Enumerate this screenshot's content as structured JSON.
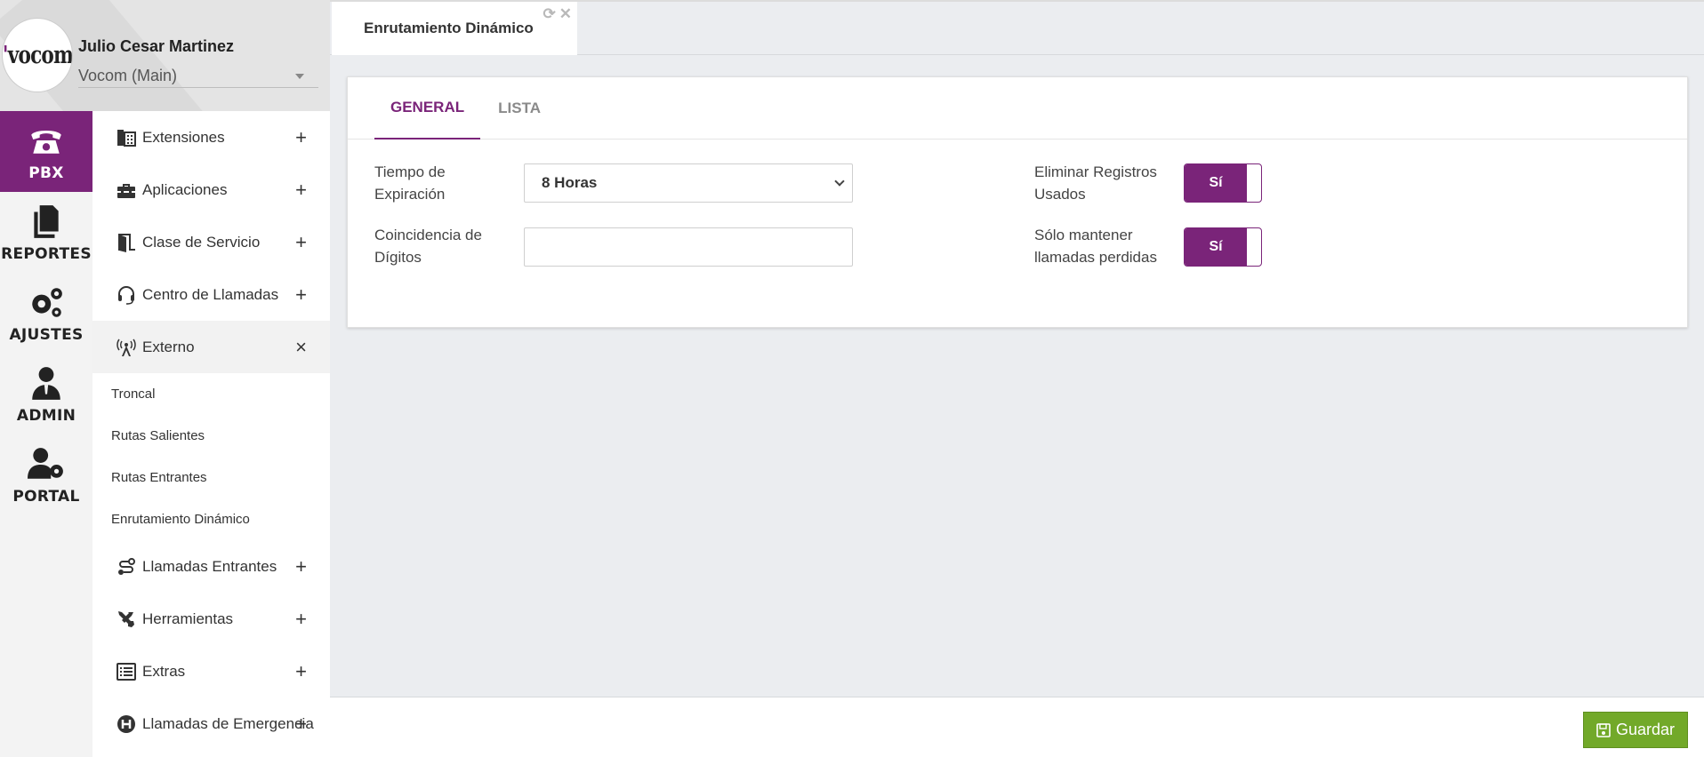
{
  "profile": {
    "user_name": "Julio Cesar Martinez",
    "tenant": "Vocom (Main)",
    "logo_icon": "vocom-logo"
  },
  "rail": {
    "items": [
      {
        "label": "PBX",
        "icon": "phone-icon",
        "active": true
      },
      {
        "label": "REPORTES",
        "icon": "documents-icon",
        "active": false
      },
      {
        "label": "AJUSTES",
        "icon": "gears-icon",
        "active": false
      },
      {
        "label": "ADMIN",
        "icon": "user-tie-icon",
        "active": false
      },
      {
        "label": "PORTAL",
        "icon": "user-gear-icon",
        "active": false
      }
    ]
  },
  "menu": {
    "items": [
      {
        "label": "Extensiones",
        "icon": "building-phone-icon",
        "toggle": "+"
      },
      {
        "label": "Aplicaciones",
        "icon": "toolbox-icon",
        "toggle": "+"
      },
      {
        "label": "Clase de Servicio",
        "icon": "door-open-icon",
        "toggle": "+"
      },
      {
        "label": "Centro de Llamadas",
        "icon": "headset-icon",
        "toggle": "+"
      },
      {
        "label": "Externo",
        "icon": "broadcast-tower-icon",
        "toggle": "×"
      }
    ],
    "sub_items": [
      "Troncal",
      "Rutas Salientes",
      "Rutas Entrantes",
      "Enrutamiento Dinámico"
    ],
    "items_after": [
      {
        "label": "Llamadas Entrantes",
        "icon": "route-icon",
        "toggle": "+"
      },
      {
        "label": "Herramientas",
        "icon": "tools-icon",
        "toggle": "+"
      },
      {
        "label": "Extras",
        "icon": "list-icon",
        "toggle": "+"
      },
      {
        "label": "Llamadas de Emergencia",
        "icon": "hospital-icon",
        "toggle": "+"
      }
    ]
  },
  "doc_tab": {
    "title": "Enrutamiento Dinámico",
    "refresh_icon": "refresh-icon",
    "close_icon": "close-icon"
  },
  "tabs": [
    {
      "label": "GENERAL",
      "active": true
    },
    {
      "label": "LISTA",
      "active": false
    }
  ],
  "form": {
    "expiration_label": "Tiempo de Expiración",
    "expiration_value": "8 Horas",
    "digits_label": "Coincidencia de Dígitos",
    "digits_value": "",
    "delete_used_label": "Eliminar Registros Usados",
    "delete_used_value": "Sí",
    "keep_missed_label": "Sólo mantener llamadas perdidas",
    "keep_missed_value": "Sí"
  },
  "footer": {
    "save_label": "Guardar",
    "save_icon": "save-icon"
  },
  "colors": {
    "accent": "#7a2479",
    "save": "#72a929"
  }
}
